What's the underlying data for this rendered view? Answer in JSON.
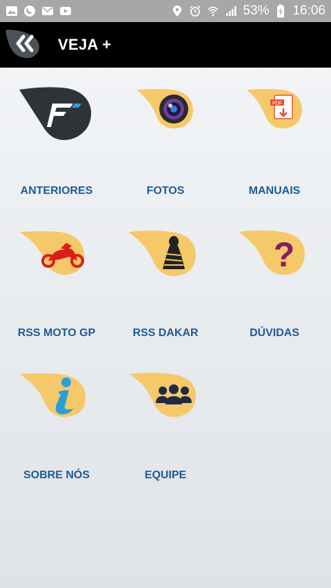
{
  "status_bar": {
    "battery": "53%",
    "time": "16:06",
    "left_icons": [
      "gallery-icon",
      "moon-app-icon",
      "mail-icon",
      "youtube-icon"
    ],
    "right_icons": [
      "location-pin-icon",
      "alarm-icon",
      "wifi-icon",
      "signal-icon",
      "battery-charging-icon"
    ]
  },
  "app_bar": {
    "title": "VEJA +",
    "back_icon": "double-chevron-left-icon"
  },
  "colors": {
    "tile_yellow": "#f5c86a",
    "label_blue": "#1d5a96",
    "app_bar": "#000000",
    "status_bar": "#a7a7a7"
  },
  "menu": {
    "items": [
      {
        "label": "ANTERIORES",
        "icon": "brand-logo-icon"
      },
      {
        "label": "FOTOS",
        "icon": "camera-lens-icon"
      },
      {
        "label": "MANUAIS",
        "icon": "pdf-download-icon"
      },
      {
        "label": "RSS MOTO GP",
        "icon": "motorcycle-icon"
      },
      {
        "label": "RSS DAKAR",
        "icon": "dakar-tuareg-icon"
      },
      {
        "label": "DÚVIDAS",
        "icon": "question-mark-icon"
      },
      {
        "label": "SOBRE NÓS",
        "icon": "info-icon"
      },
      {
        "label": "EQUIPE",
        "icon": "team-icon"
      }
    ]
  }
}
